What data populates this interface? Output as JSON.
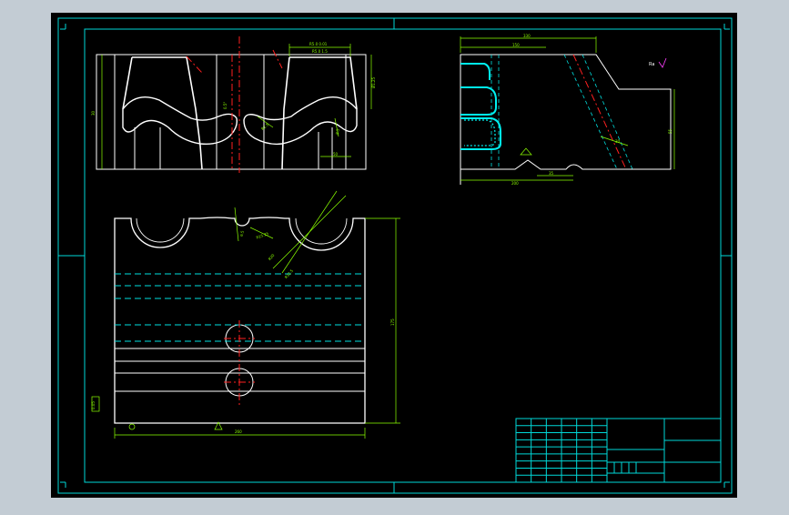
{
  "colors": {
    "background": "#c3ccd4",
    "sheet": "#000000",
    "frame": "#00d8d8",
    "geometry": "#ffffff",
    "dimension": "#8cff00",
    "centerline": "#ff2020",
    "hidden": "#00e0e0",
    "surface": "#00f0f0"
  },
  "front_view": {
    "dim_top_a": "R5.0 0.01",
    "dim_top_b": "R5.0 1.5",
    "dim_left": "30",
    "dim_right": "Ø1.25",
    "dim_angle": "0.5°",
    "dim_bottom_right": "50",
    "dim_slot": "R2.5",
    "dim_inner": "8.5"
  },
  "side_view": {
    "dim_top": "330",
    "dim_top_inner": "150",
    "dim_right": "55",
    "dim_bottom_left": "200",
    "dim_bottom_mid": "35",
    "dim_angle": "30",
    "note": "Ra"
  },
  "plan_view": {
    "dim_width": "260",
    "dim_height": "175",
    "dim_radius_a": "R20",
    "dim_radius_b": "R32.5",
    "dim_radius_c": "R15.25",
    "dim_small": "6.5",
    "stamp": "0.05"
  },
  "title_block": {
    "rows": 9,
    "cols": 6
  }
}
